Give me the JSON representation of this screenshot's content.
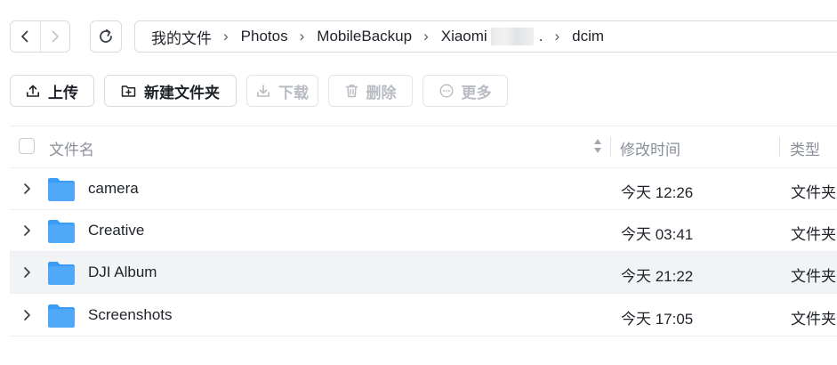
{
  "navigation": {
    "back_icon": "chevron-left-icon",
    "forward_icon": "chevron-right-icon",
    "refresh_icon": "refresh-icon"
  },
  "breadcrumb": {
    "items": [
      "我的文件",
      "Photos",
      "MobileBackup",
      "Xiaomi",
      "dcim"
    ],
    "redacted_suffix": ".",
    "separator": "›"
  },
  "toolbar": {
    "upload_label": "上传",
    "new_folder_label": "新建文件夹",
    "download_label": "下载",
    "delete_label": "删除",
    "more_label": "更多"
  },
  "list": {
    "columns": {
      "name": "文件名",
      "modified": "修改时间",
      "type": "类型"
    },
    "rows": [
      {
        "name": "camera",
        "modified": "今天 12:26",
        "type": "文件夹"
      },
      {
        "name": "Creative",
        "modified": "今天 03:41",
        "type": "文件夹"
      },
      {
        "name": "DJI Album",
        "modified": "今天 21:22",
        "type": "文件夹"
      },
      {
        "name": "Screenshots",
        "modified": "今天 17:05",
        "type": "文件夹"
      }
    ]
  },
  "colors": {
    "folder": "#3b9cf5",
    "border": "#d9dce1",
    "hover_row": "#f2f3f5",
    "muted_text": "#8a8f98",
    "disabled_text": "#b8bbc1"
  }
}
